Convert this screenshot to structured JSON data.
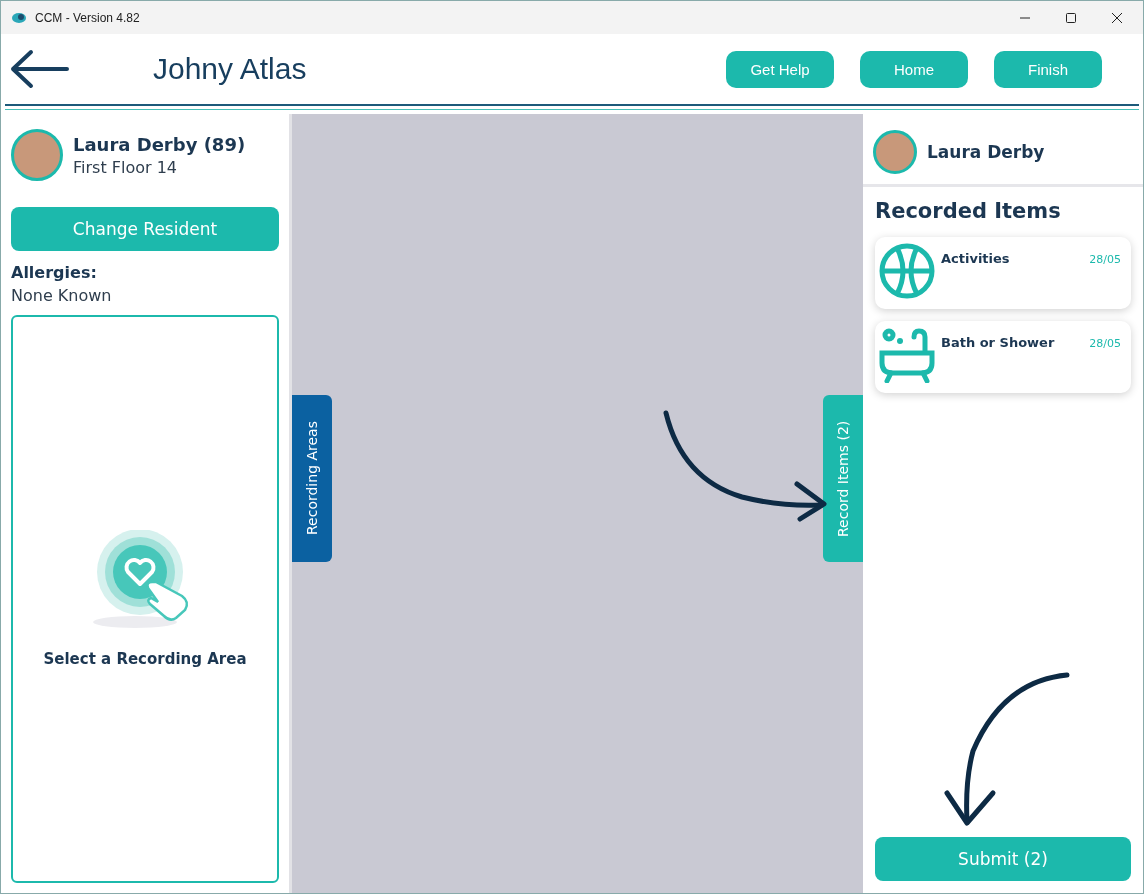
{
  "window": {
    "title": "CCM - Version 4.82"
  },
  "header": {
    "title": "Johny Atlas",
    "buttons": [
      "Get Help",
      "Home",
      "Finish"
    ]
  },
  "resident": {
    "name": "Laura Derby (89)",
    "location": "First Floor 14"
  },
  "change_button": "Change Resident",
  "allergies": {
    "label": "Allergies:",
    "value": "None Known"
  },
  "empty_state": "Select a Recording Area",
  "side_tabs": [
    {
      "label": "Recording Areas",
      "kind": "left"
    },
    {
      "label": "Record Items (2)",
      "kind": "right"
    }
  ],
  "panel": {
    "resident_name": "Laura Derby",
    "heading": "Recorded Items",
    "items": [
      {
        "kind": "activities",
        "label": "Activities",
        "date": "28/05"
      },
      {
        "kind": "bath",
        "label": "Bath or Shower",
        "date": "28/05"
      }
    ],
    "submit": "Submit (2)"
  }
}
